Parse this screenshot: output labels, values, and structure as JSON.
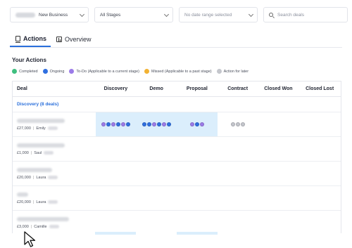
{
  "filters": {
    "pipeline": "New Business",
    "stages": "All Stages",
    "date_range": "No date range selected",
    "search_placeholder": "Search deals"
  },
  "tabs": [
    {
      "label": "Actions",
      "icon": "clipboard-icon",
      "active": true
    },
    {
      "label": "Overview",
      "icon": "bar-chart-icon",
      "active": false
    }
  ],
  "section_title": "Your Actions",
  "legend": [
    {
      "label": "Completed",
      "color": "#3fbf7f"
    },
    {
      "label": "Ongoing",
      "color": "#2f6fe0"
    },
    {
      "label": "To-Do (Applicable to a current stage)",
      "color": "#9b7be8"
    },
    {
      "label": "Missed (Applicable to a past stage)",
      "color": "#f2b233"
    },
    {
      "label": "Action for later",
      "color": "#c4c6cc"
    }
  ],
  "table": {
    "columns": [
      "Deal",
      "Discovery",
      "Demo",
      "Proposal",
      "Contract",
      "Closed Won",
      "Closed Lost"
    ],
    "group_label": "Discovery (8 deals)",
    "rows": [
      {
        "amount": "£27,000",
        "owner": "Emily"
      },
      {
        "amount": "£1,000",
        "owner": "Saul"
      },
      {
        "amount": "£20,000",
        "owner": "Laura"
      },
      {
        "amount": "£20,000",
        "owner": "Laura"
      },
      {
        "amount": "£3,000",
        "owner": "Camille"
      }
    ]
  },
  "colors": {
    "accent": "#2a6fdb",
    "highlight": "#dbeefc",
    "ongoing": "#2f6fe0",
    "todo": "#9b7be8",
    "later": "#c4c6cc"
  }
}
